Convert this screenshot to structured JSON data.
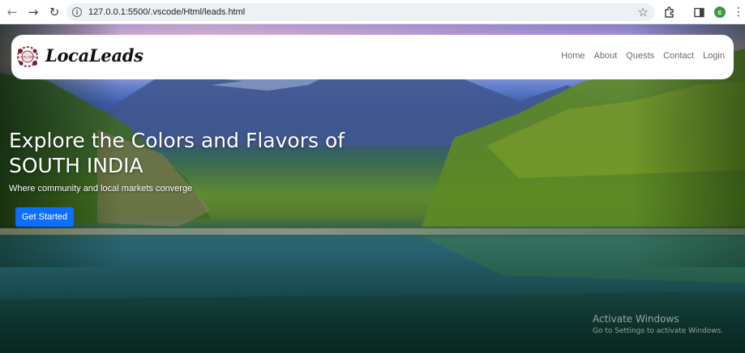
{
  "browser": {
    "url": "127.0.0.1:5500/.vscode/Html/leads.html",
    "profile_initial": "c"
  },
  "site": {
    "brand": "LocaLeads",
    "logo_text": "LOCAL LEADS",
    "nav": [
      "Home",
      "About",
      "Quests",
      "Contact",
      "Login"
    ]
  },
  "hero": {
    "title_line1": "Explore the Colors and Flavors of",
    "title_line2": "SOUTH INDIA",
    "subtitle": "Where community and local markets converge",
    "cta_label": "Get Started"
  },
  "watermark": {
    "title": "Activate Windows",
    "subtitle": "Go to Settings to activate Windows."
  },
  "colors": {
    "cta": "#0d6efd",
    "navbar_bg": "#ffffff",
    "avatar": "#3f9a3f"
  }
}
